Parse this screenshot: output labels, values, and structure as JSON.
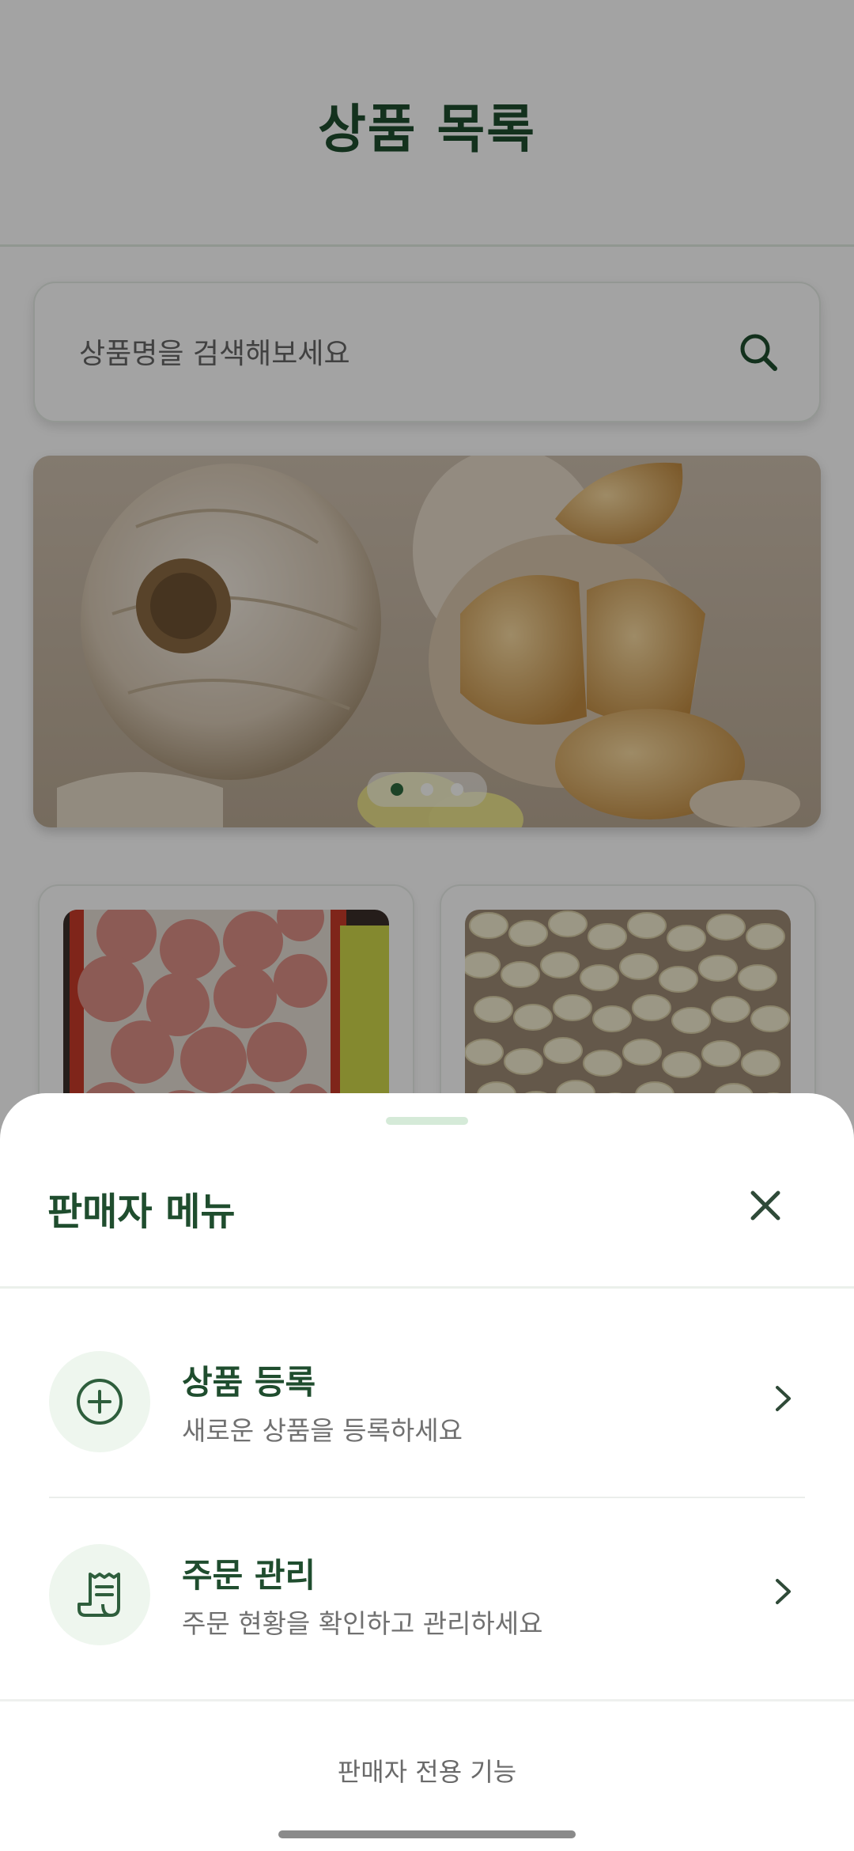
{
  "app": {
    "page_title": "상품 목록"
  },
  "search": {
    "placeholder": "상품명을 검색해보세요",
    "icon": "search-icon"
  },
  "banner": {
    "slide_count": 3,
    "active_slide": 1
  },
  "products": [
    {
      "image": "peaches-in-box"
    },
    {
      "image": "peeled-garlic-cloves"
    }
  ],
  "seller_menu": {
    "title": "판매자 메뉴",
    "close_icon": "close-icon",
    "items": [
      {
        "icon": "plus-circle-icon",
        "title": "상품 등록",
        "subtitle": "새로운 상품을 등록하세요",
        "chevron": "chevron-right-icon"
      },
      {
        "icon": "receipt-icon",
        "title": "주문 관리",
        "subtitle": "주문 현황을 확인하고 관리하세요",
        "chevron": "chevron-right-icon"
      }
    ],
    "footer": "판매자 전용 기능"
  },
  "colors": {
    "brand_green": "#1f4d2e",
    "accent_light": "#eef6ee",
    "overlay": "rgba(0,0,0,0.36)"
  }
}
